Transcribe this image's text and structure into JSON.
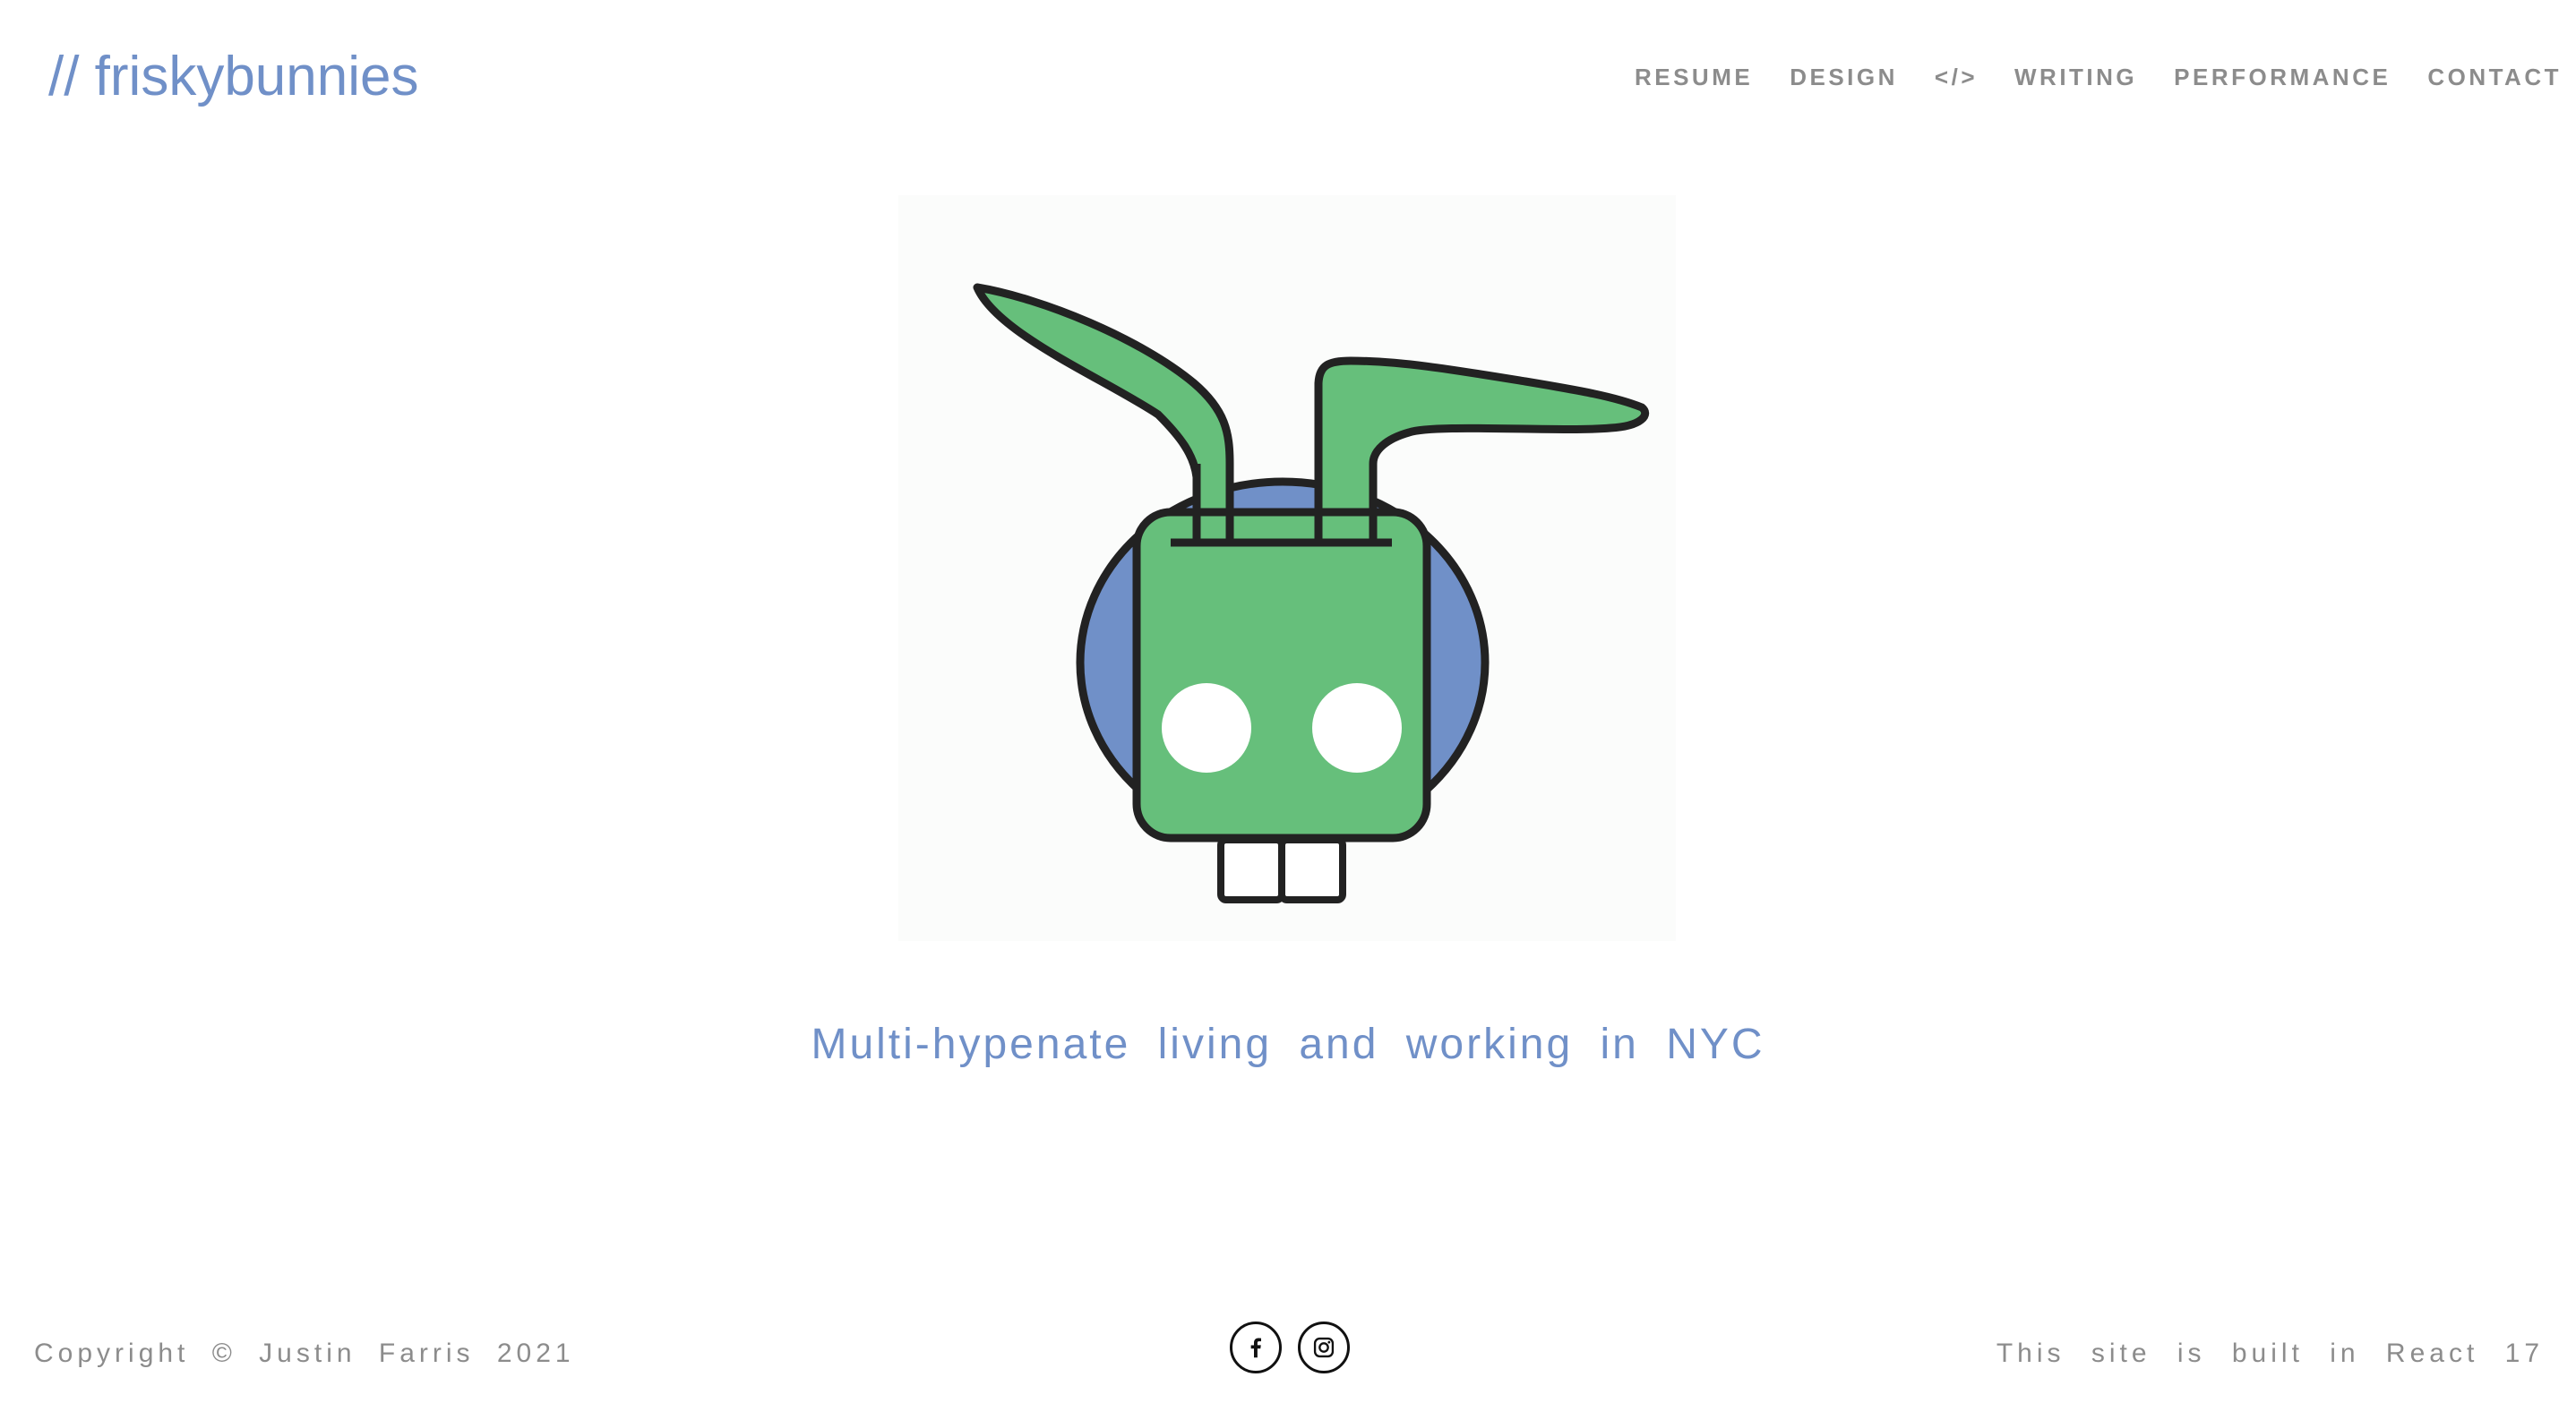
{
  "header": {
    "logo_text": "// friskybunnies",
    "nav": [
      {
        "label": "RESUME"
      },
      {
        "label": "DESIGN"
      },
      {
        "label": "</>"
      },
      {
        "label": "WRITING"
      },
      {
        "label": "PERFORMANCE"
      },
      {
        "label": "CONTACT"
      }
    ]
  },
  "hero": {
    "image_icon": "bunny-robot-icon",
    "tagline": "Multi-hypenate living and working in NYC"
  },
  "footer": {
    "copyright": "Copyright © Justin Farris 2021",
    "social": [
      {
        "icon": "facebook-icon"
      },
      {
        "icon": "instagram-icon"
      }
    ],
    "built_with": "This site is built in React 17"
  },
  "colors": {
    "brand_blue": "#7090c8",
    "bunny_green": "#66bf7b",
    "outline": "#222222",
    "nav_gray": "#8c8c8c"
  }
}
